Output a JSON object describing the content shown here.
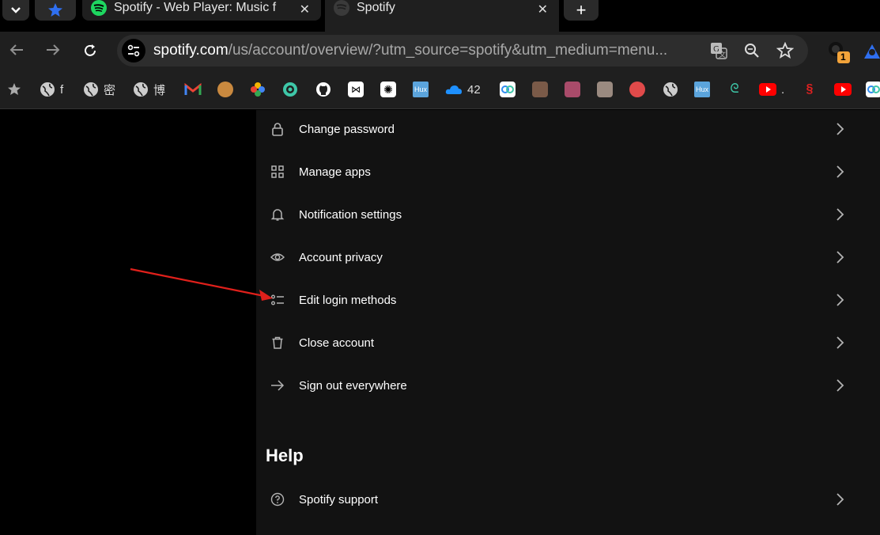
{
  "browser": {
    "tabs": [
      {
        "title": "Spotify - Web Player: Music f",
        "state": "inactive"
      },
      {
        "title": "Spotify",
        "state": "active"
      }
    ],
    "url_host": "spotify.com",
    "url_path": "/us/account/overview/?utm_source=spotify&utm_medium=menu...",
    "extension_badge": "1",
    "bookmarks": [
      {
        "label": "f",
        "icon": "globe-icon"
      },
      {
        "label": "密",
        "icon": "globe-icon"
      },
      {
        "label": "博",
        "icon": "globe-icon"
      },
      {
        "label": "42",
        "icon": "onedrive-icon"
      },
      {
        "label": ".",
        "icon": "youtube-icon"
      }
    ]
  },
  "menu": {
    "items": [
      {
        "label": "Change password",
        "icon": "lock-icon"
      },
      {
        "label": "Manage apps",
        "icon": "grid-icon"
      },
      {
        "label": "Notification settings",
        "icon": "bell-icon"
      },
      {
        "label": "Account privacy",
        "icon": "eye-icon"
      },
      {
        "label": "Edit login methods",
        "icon": "list-icon"
      },
      {
        "label": "Close account",
        "icon": "trash-icon"
      },
      {
        "label": "Sign out everywhere",
        "icon": "arrow-right-icon"
      }
    ]
  },
  "help": {
    "title": "Help",
    "items": [
      {
        "label": "Spotify support",
        "icon": "question-circle-icon"
      }
    ]
  },
  "colors": {
    "panel_bg": "#121212",
    "page_bg": "#000000",
    "annotation_arrow": "#e0201b",
    "spotify_green": "#1ed760"
  }
}
